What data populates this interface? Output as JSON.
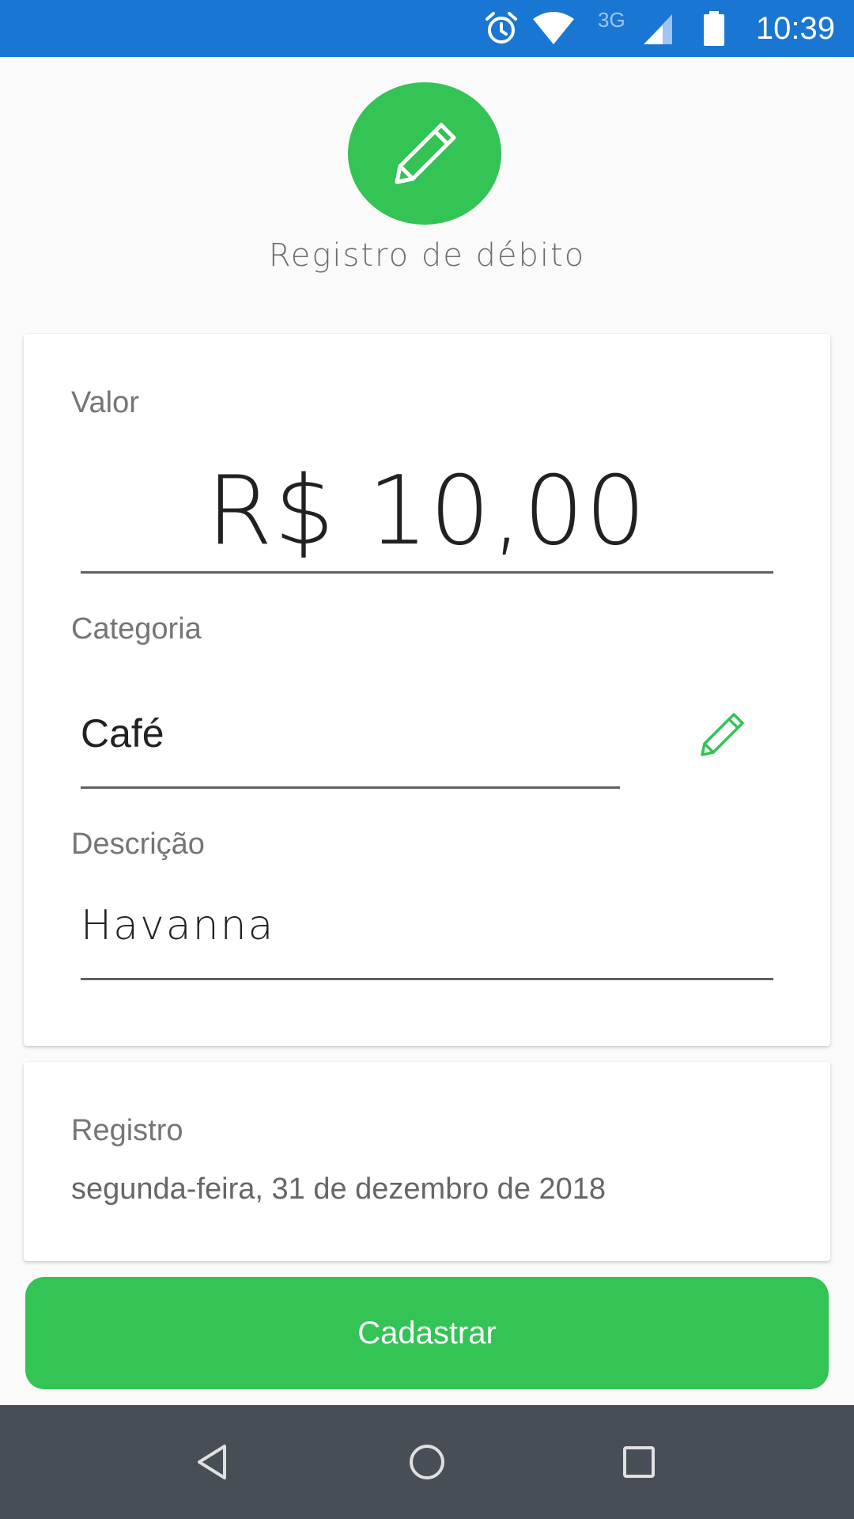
{
  "status_bar": {
    "time": "10:39",
    "network_type": "3G",
    "icons": [
      "alarm-icon",
      "wifi-icon",
      "cellular-signal-icon",
      "battery-icon"
    ],
    "color": "#1976d2"
  },
  "header": {
    "icon": "pencil-icon",
    "title": "Registro de débito"
  },
  "form": {
    "amount_label": "Valor",
    "amount_value": "R$ 10,00",
    "category_label": "Categoria",
    "category_value": "Café",
    "category_edit_icon": "pencil-icon",
    "description_label": "Descrição",
    "description_value": "Havanna"
  },
  "record": {
    "label": "Registro",
    "date": "segunda-feira, 31 de dezembro de 2018"
  },
  "submit_button": {
    "label": "Cadastrar"
  },
  "nav_bar": {
    "icons": [
      "back-icon",
      "home-icon",
      "recents-icon"
    ]
  },
  "colors": {
    "accent_green": "#34c355",
    "status_bar_blue": "#1976d2",
    "nav_bar": "#474e56"
  }
}
